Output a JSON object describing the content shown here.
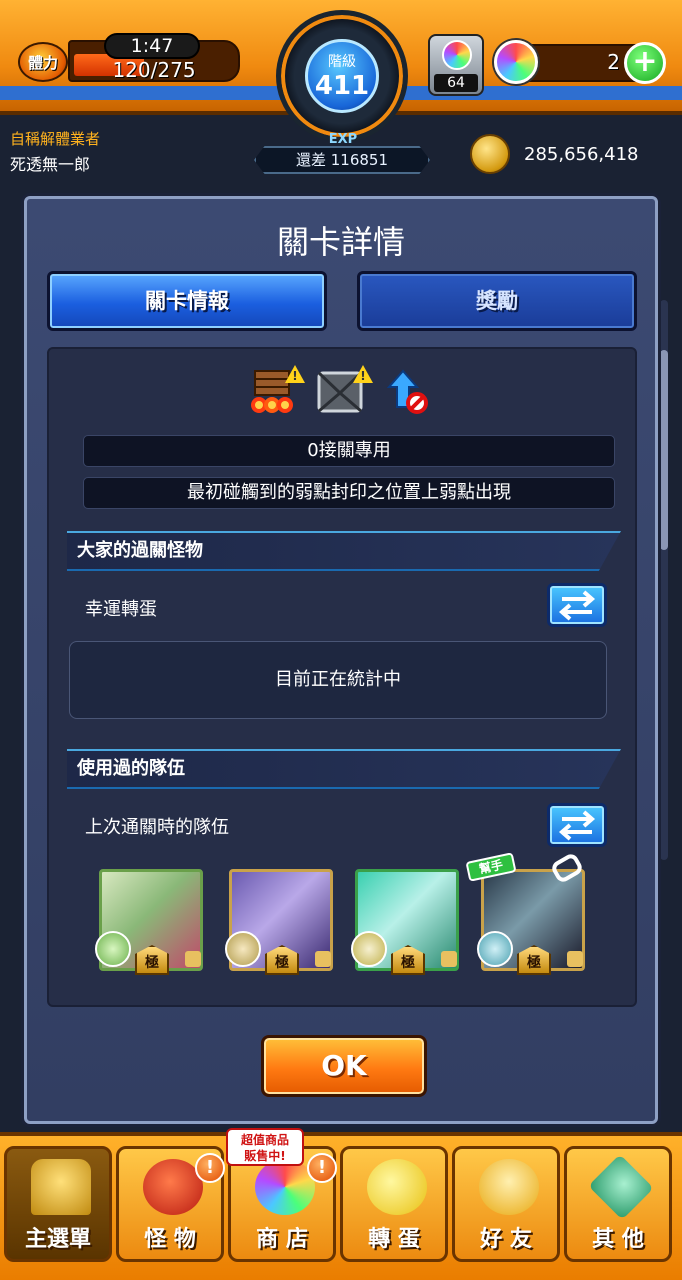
{
  "hud": {
    "stamina_icon_label": "體力",
    "stamina_timer": "1:47",
    "stamina_count": "120/275",
    "stamina_fraction": 0.436,
    "rank_label": "階級",
    "rank_value": "411",
    "exp_label": "EXP",
    "exp_remaining": "還差 116851",
    "orb_box_count": "64",
    "orb_count": "2",
    "orb_plus": "+",
    "player_title": "自稱解體業者",
    "player_name": "死透無一郎",
    "coin_count": "285,656,418"
  },
  "dialog": {
    "title": "關卡詳情",
    "tabs": [
      {
        "label": "關卡情報",
        "active": true
      },
      {
        "label": "獎勵",
        "active": false
      }
    ],
    "gimmicks": [
      "brick-wall-icon",
      "damage-wall-icon",
      "no-speedup-icon"
    ],
    "info_lines": [
      "0接關專用",
      "最初碰觸到的弱點封印之位置上弱點出現"
    ],
    "section_clear_monsters": {
      "header": "大家的過關怪物",
      "row_label": "幸運轉蛋",
      "status": "目前正在統計中"
    },
    "section_used_team": {
      "header": "使用過的隊伍",
      "row_label": "上次通關時的隊伍",
      "cards": [
        {
          "rank": "極",
          "assist": ""
        },
        {
          "rank": "極",
          "assist": ""
        },
        {
          "rank": "極",
          "assist": ""
        },
        {
          "rank": "極",
          "assist": "幫手"
        }
      ]
    },
    "ok_label": "OK"
  },
  "nav": {
    "items": [
      {
        "label": "主選單",
        "active": true,
        "badge": ""
      },
      {
        "label": "怪 物",
        "active": false,
        "badge": "!"
      },
      {
        "label": "商 店",
        "active": false,
        "badge": "!"
      },
      {
        "label": "轉 蛋",
        "active": false,
        "badge": ""
      },
      {
        "label": "好 友",
        "active": false,
        "badge": ""
      },
      {
        "label": "其 他",
        "active": false,
        "badge": ""
      }
    ],
    "shop_tag_line1": "超值商品",
    "shop_tag_line2": "販售中!"
  }
}
